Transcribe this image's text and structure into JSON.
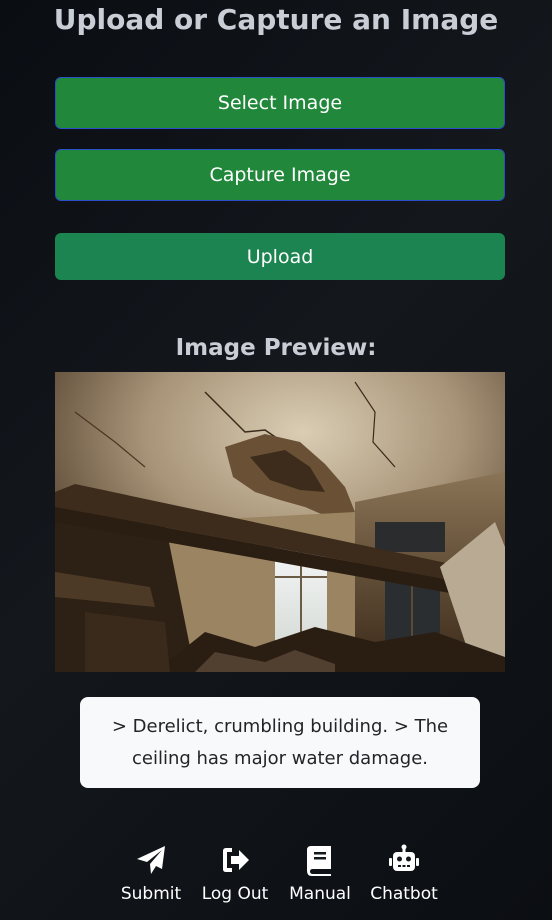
{
  "page": {
    "title": "Upload or Capture an Image"
  },
  "buttons": {
    "select_label": "Select Image",
    "capture_label": "Capture Image",
    "upload_label": "Upload"
  },
  "preview": {
    "heading": "Image Preview:"
  },
  "result": {
    "caption": "> Derelict, crumbling building. > The ceiling has major water damage."
  },
  "nav": {
    "items": [
      {
        "label": "Submit",
        "icon": "paper-plane-icon"
      },
      {
        "label": "Log Out",
        "icon": "logout-icon"
      },
      {
        "label": "Manual",
        "icon": "book-icon"
      },
      {
        "label": "Chatbot",
        "icon": "robot-icon"
      }
    ]
  },
  "colors": {
    "primary_button": "#21873a",
    "upload_button": "#1c8450",
    "button_border": "#2b4fc9",
    "heading_text": "#c9ced6",
    "caption_background": "#f8f9fa",
    "background": "#0f1317"
  }
}
